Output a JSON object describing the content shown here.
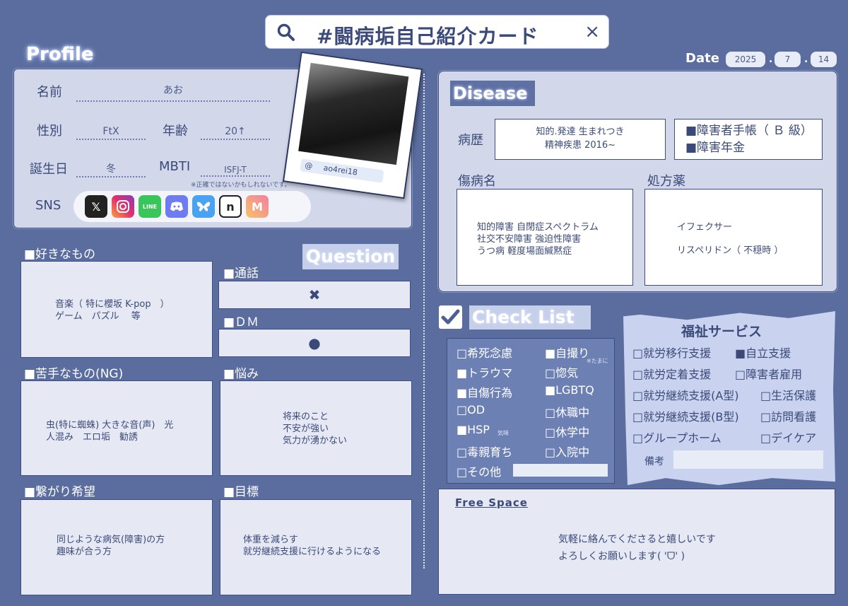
{
  "search": {
    "query": "#闘病垢自己紹介カード",
    "close": "×"
  },
  "profile": {
    "title": "Profile",
    "name_label": "名前",
    "name": "あお",
    "gender_label": "性別",
    "gender": "FtX",
    "age_label": "年齢",
    "age": "20↑",
    "birthday_label": "誕生日",
    "birthday": "冬",
    "mbti_label": "MBTI",
    "mbti": "ISFJ-T",
    "mbti_note": "※正確ではないかもしれないです。",
    "sns_label": "SNS",
    "sns_icons": [
      "x-icon",
      "instagram-icon",
      "line-icon",
      "discord-icon",
      "bluesky-icon",
      "note-icon",
      "misskey-icon"
    ],
    "handle_at": "@",
    "handle": "ao4rei18"
  },
  "date": {
    "label": "Date",
    "year": "2025",
    "month": "7",
    "day": "14",
    "sep": "."
  },
  "likes": {
    "title": "■好きなもの",
    "lines": [
      "音楽（ 特に櫻坂 K-pop　）",
      "ゲーム　パズル　 等"
    ]
  },
  "question": {
    "title": "Question"
  },
  "call": {
    "title": "■通話",
    "mark": "✖"
  },
  "dm": {
    "title": "■ＤＭ",
    "mark": "●"
  },
  "dislikes": {
    "title": "■苦手なもの(NG)",
    "lines": [
      "虫(特に蜘蛛) 大きな音(声)　光",
      "人混み　エロ垢　勧誘"
    ]
  },
  "worries": {
    "title": "■悩み",
    "lines": [
      "将来のこと",
      "不安が強い",
      "気力が湧かない"
    ]
  },
  "connect": {
    "title": "■繋がり希望",
    "lines": [
      "同じような病気(障害)の方",
      "趣味が合う方"
    ]
  },
  "goals": {
    "title": "■目標",
    "lines": [
      "体重を減らす",
      "就労継続支援に行けるようになる"
    ]
  },
  "disease": {
    "title": "Disease",
    "history_label": "病歴",
    "history_lines": [
      "知的.発達 生まれつき",
      "精神疾患 2016~"
    ],
    "cert_lines": [
      "■障害者手帳（ Ｂ 級）",
      "■障害年金"
    ],
    "diagnosis_label": "傷病名",
    "diagnosis_lines": [
      "知的障害 自閉症スペクトラム",
      "社交不安障害 強迫性障害",
      "うつ病 軽度場面緘黙症"
    ],
    "meds_label": "処方薬",
    "meds_lines": [
      "イフェクサー",
      "リスペリドン（ 不穏時 ）"
    ]
  },
  "checklist": {
    "title": "Check List",
    "left": [
      "□希死念慮",
      "■トラウマ",
      "■自傷行為",
      "□OD",
      "■HSP",
      "□毒親育ち",
      "□その他"
    ],
    "right": [
      "■自撮り",
      "□惚気",
      "■LGBTQ",
      "□休職中",
      "□休学中",
      "□入院中"
    ],
    "hsp_note": "気味",
    "selfie_note": "※たまに"
  },
  "welfare": {
    "title": "福祉サービス",
    "rows": [
      [
        "□就労移行支援",
        "■自立支援"
      ],
      [
        "□就労定着支援",
        "□障害者雇用"
      ],
      [
        "□就労継続支援(A型)",
        "□生活保護"
      ],
      [
        "□就労継続支援(B型)",
        "□訪問看護"
      ],
      [
        "□グループホーム",
        "□デイケア"
      ]
    ],
    "memo_label": "備考"
  },
  "free": {
    "title": "Free Space",
    "lines": [
      "気軽に絡んでくださると嬉しいです",
      "よろしくお願いします( 'ᗜ' )"
    ]
  }
}
